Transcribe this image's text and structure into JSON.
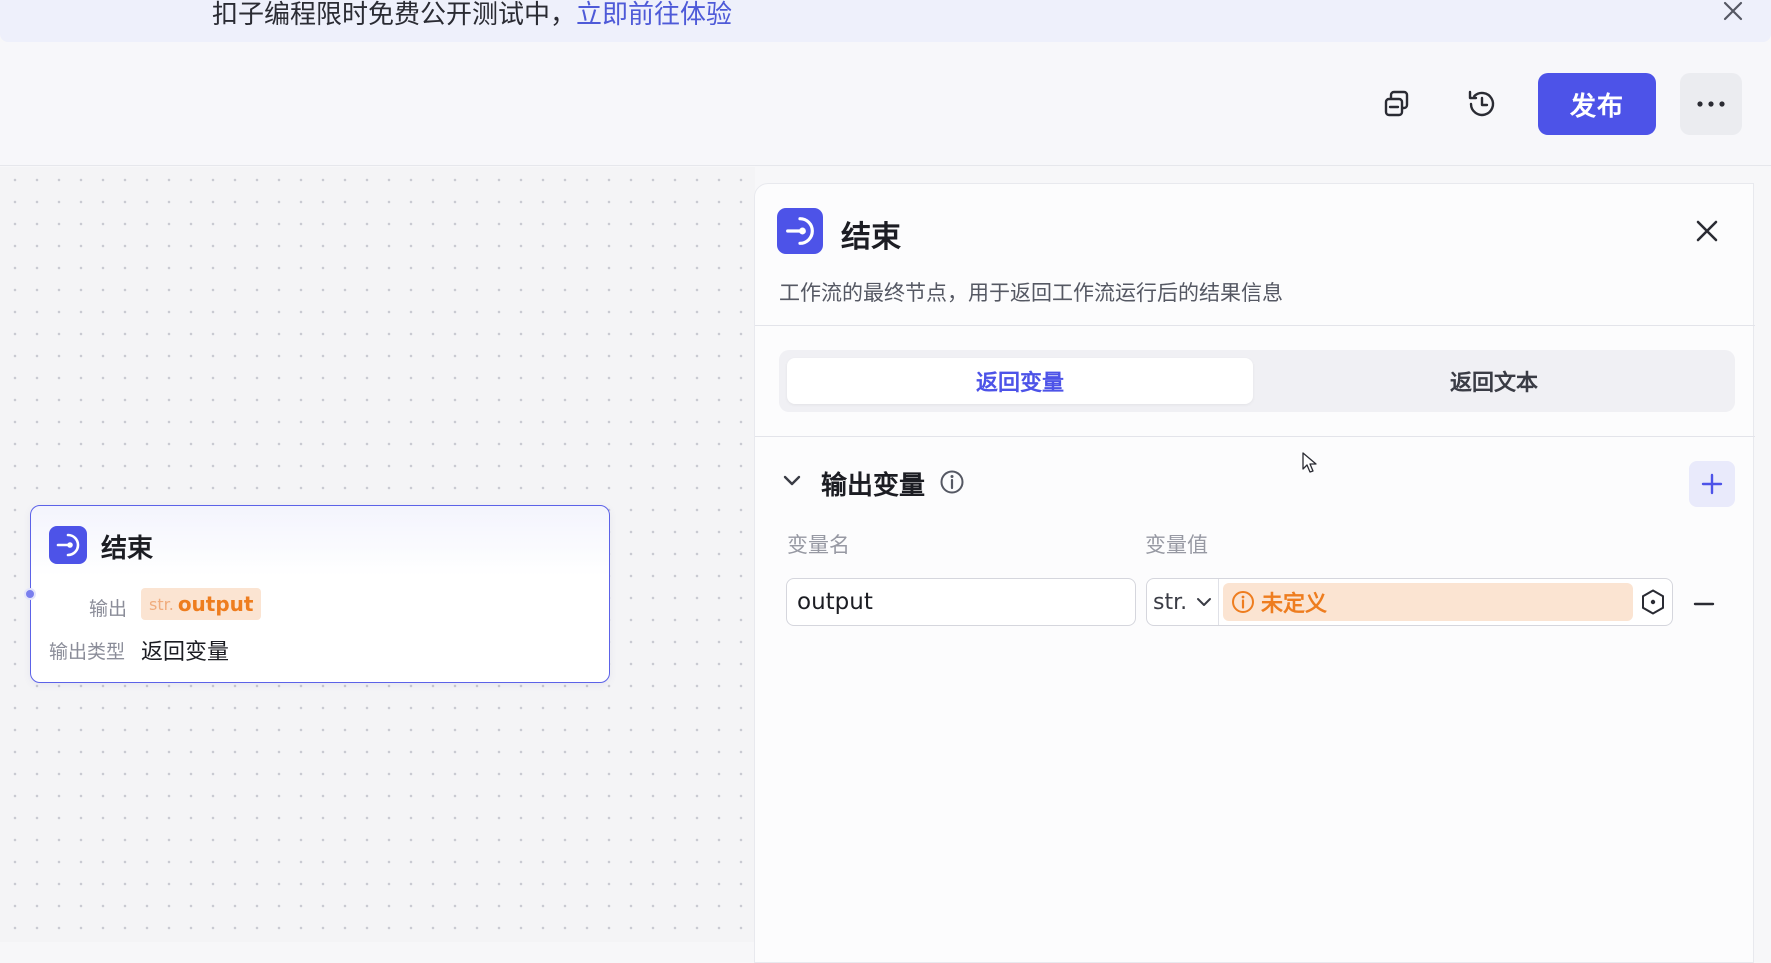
{
  "banner": {
    "text": "扣子编程限时免费公开测试中，",
    "link": "立即前往体验"
  },
  "toolbar": {
    "publish_label": "发布"
  },
  "node": {
    "title": "结束",
    "output_label": "输出",
    "output_type": "str.",
    "output_name": "output",
    "output_type_label": "输出类型",
    "output_type_value": "返回变量"
  },
  "panel": {
    "title": "结束",
    "description": "工作流的最终节点，用于返回工作流运行后的结果信息",
    "tabs": [
      {
        "label": "返回变量",
        "active": true
      },
      {
        "label": "返回文本",
        "active": false
      }
    ],
    "section_title": "输出变量",
    "columns": {
      "name": "变量名",
      "value": "变量值"
    },
    "rows": [
      {
        "name": "output",
        "type": "str.",
        "value": "未定义"
      }
    ]
  },
  "colors": {
    "accent": "#4d53e8",
    "warning": "#ee7d1f",
    "warning_bg": "#fbe4d2"
  },
  "icons": {
    "node": "end-node-icon",
    "copy": "copy-icon",
    "history": "history-icon",
    "more": "more-icon",
    "close": "close-icon",
    "info": "info-icon",
    "add": "plus-icon",
    "remove": "minus-icon",
    "ref": "variable-ref-icon"
  }
}
